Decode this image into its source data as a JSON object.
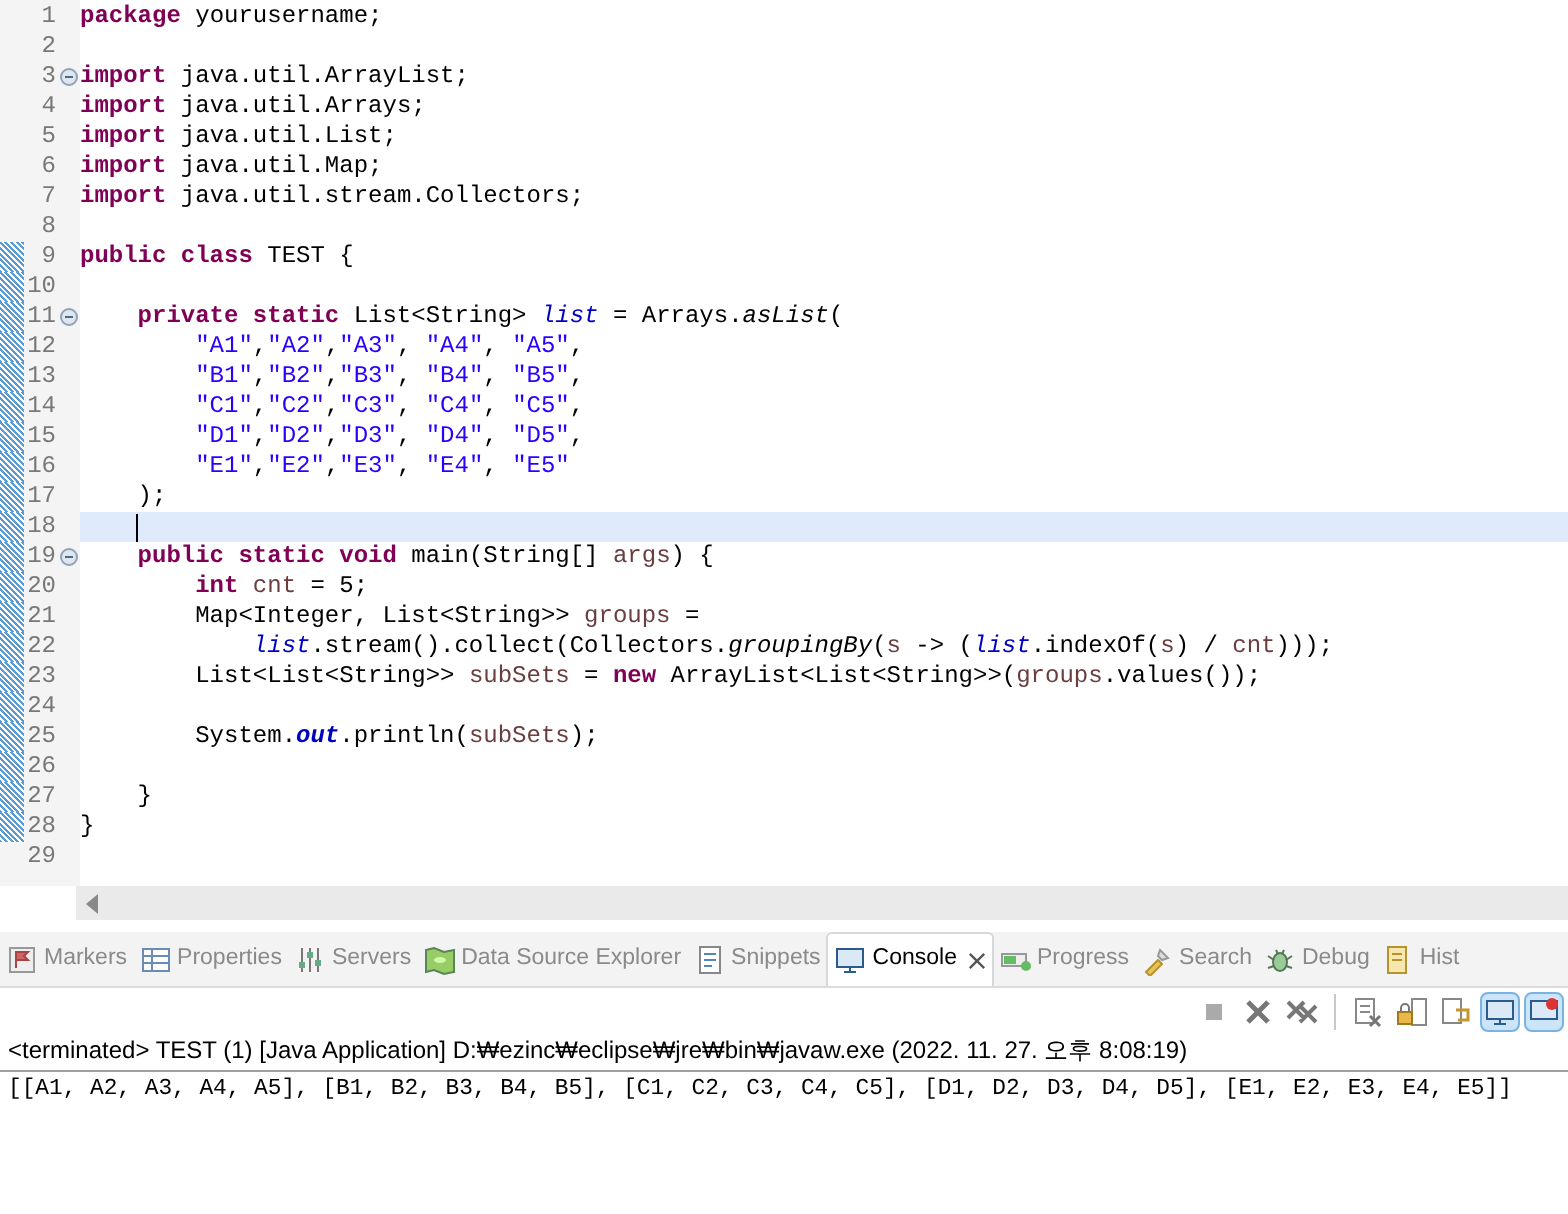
{
  "editor": {
    "lines": [
      {
        "number": "1",
        "fold": false,
        "changed": false,
        "current": false,
        "tokens": [
          {
            "kind": "keyword",
            "text": "package"
          },
          {
            "kind": "plain",
            "text": " yourusername;"
          }
        ]
      },
      {
        "number": "2",
        "fold": false,
        "changed": false,
        "current": false
      },
      {
        "number": "3",
        "fold": true,
        "changed": false,
        "current": false,
        "tokens": [
          {
            "kind": "keyword",
            "text": "import"
          },
          {
            "kind": "plain",
            "text": " java.util.ArrayList;"
          }
        ]
      },
      {
        "number": "4",
        "fold": false,
        "changed": false,
        "current": false,
        "tokens": [
          {
            "kind": "keyword",
            "text": "import"
          },
          {
            "kind": "plain",
            "text": " java.util.Arrays;"
          }
        ]
      },
      {
        "number": "5",
        "fold": false,
        "changed": false,
        "current": false,
        "tokens": [
          {
            "kind": "keyword",
            "text": "import"
          },
          {
            "kind": "plain",
            "text": " java.util.List;"
          }
        ]
      },
      {
        "number": "6",
        "fold": false,
        "changed": false,
        "current": false,
        "tokens": [
          {
            "kind": "keyword",
            "text": "import"
          },
          {
            "kind": "plain",
            "text": " java.util.Map;"
          }
        ]
      },
      {
        "number": "7",
        "fold": false,
        "changed": false,
        "current": false,
        "tokens": [
          {
            "kind": "keyword",
            "text": "import"
          },
          {
            "kind": "plain",
            "text": " java.util.stream.Collectors;"
          }
        ]
      },
      {
        "number": "8",
        "fold": false,
        "changed": false,
        "current": false
      },
      {
        "number": "9",
        "fold": false,
        "changed": true,
        "current": false,
        "tokens": [
          {
            "kind": "keyword",
            "text": "public class"
          },
          {
            "kind": "plain",
            "text": " TEST {"
          }
        ]
      },
      {
        "number": "10",
        "fold": false,
        "changed": true,
        "current": false
      },
      {
        "number": "11",
        "fold": true,
        "changed": true,
        "current": false,
        "tokens": [
          {
            "kind": "keyword",
            "text": "    private static"
          },
          {
            "kind": "plain",
            "text": " List<String> "
          },
          {
            "kind": "field",
            "text": "list"
          },
          {
            "kind": "plain",
            "text": " = Arrays."
          },
          {
            "kind": "static-method",
            "text": "asList"
          },
          {
            "kind": "plain",
            "text": "("
          }
        ]
      },
      {
        "number": "12",
        "fold": false,
        "changed": true,
        "current": false,
        "tokens": [
          {
            "kind": "string",
            "text": "        \"A1\""
          },
          {
            "kind": "plain",
            "text": ","
          },
          {
            "kind": "string",
            "text": "\"A2\""
          },
          {
            "kind": "plain",
            "text": ","
          },
          {
            "kind": "string",
            "text": "\"A3\""
          },
          {
            "kind": "plain",
            "text": ", "
          },
          {
            "kind": "string",
            "text": "\"A4\""
          },
          {
            "kind": "plain",
            "text": ", "
          },
          {
            "kind": "string",
            "text": "\"A5\""
          },
          {
            "kind": "plain",
            "text": ","
          }
        ]
      },
      {
        "number": "13",
        "fold": false,
        "changed": true,
        "current": false,
        "tokens": [
          {
            "kind": "string",
            "text": "        \"B1\""
          },
          {
            "kind": "plain",
            "text": ","
          },
          {
            "kind": "string",
            "text": "\"B2\""
          },
          {
            "kind": "plain",
            "text": ","
          },
          {
            "kind": "string",
            "text": "\"B3\""
          },
          {
            "kind": "plain",
            "text": ", "
          },
          {
            "kind": "string",
            "text": "\"B4\""
          },
          {
            "kind": "plain",
            "text": ", "
          },
          {
            "kind": "string",
            "text": "\"B5\""
          },
          {
            "kind": "plain",
            "text": ","
          }
        ]
      },
      {
        "number": "14",
        "fold": false,
        "changed": true,
        "current": false,
        "tokens": [
          {
            "kind": "string",
            "text": "        \"C1\""
          },
          {
            "kind": "plain",
            "text": ","
          },
          {
            "kind": "string",
            "text": "\"C2\""
          },
          {
            "kind": "plain",
            "text": ","
          },
          {
            "kind": "string",
            "text": "\"C3\""
          },
          {
            "kind": "plain",
            "text": ", "
          },
          {
            "kind": "string",
            "text": "\"C4\""
          },
          {
            "kind": "plain",
            "text": ", "
          },
          {
            "kind": "string",
            "text": "\"C5\""
          },
          {
            "kind": "plain",
            "text": ","
          }
        ]
      },
      {
        "number": "15",
        "fold": false,
        "changed": true,
        "current": false,
        "tokens": [
          {
            "kind": "string",
            "text": "        \"D1\""
          },
          {
            "kind": "plain",
            "text": ","
          },
          {
            "kind": "string",
            "text": "\"D2\""
          },
          {
            "kind": "plain",
            "text": ","
          },
          {
            "kind": "string",
            "text": "\"D3\""
          },
          {
            "kind": "plain",
            "text": ", "
          },
          {
            "kind": "string",
            "text": "\"D4\""
          },
          {
            "kind": "plain",
            "text": ", "
          },
          {
            "kind": "string",
            "text": "\"D5\""
          },
          {
            "kind": "plain",
            "text": ","
          }
        ]
      },
      {
        "number": "16",
        "fold": false,
        "changed": true,
        "current": false,
        "tokens": [
          {
            "kind": "string",
            "text": "        \"E1\""
          },
          {
            "kind": "plain",
            "text": ","
          },
          {
            "kind": "string",
            "text": "\"E2\""
          },
          {
            "kind": "plain",
            "text": ","
          },
          {
            "kind": "string",
            "text": "\"E3\""
          },
          {
            "kind": "plain",
            "text": ", "
          },
          {
            "kind": "string",
            "text": "\"E4\""
          },
          {
            "kind": "plain",
            "text": ", "
          },
          {
            "kind": "string",
            "text": "\"E5\""
          }
        ]
      },
      {
        "number": "17",
        "fold": false,
        "changed": true,
        "current": false,
        "tokens": [
          {
            "kind": "plain",
            "text": "    );"
          }
        ]
      },
      {
        "number": "18",
        "fold": false,
        "changed": true,
        "current": true
      },
      {
        "number": "19",
        "fold": true,
        "changed": true,
        "current": false,
        "tokens": [
          {
            "kind": "keyword",
            "text": "    public static void"
          },
          {
            "kind": "plain",
            "text": " main(String[] "
          },
          {
            "kind": "local",
            "text": "args"
          },
          {
            "kind": "plain",
            "text": ") {"
          }
        ]
      },
      {
        "number": "20",
        "fold": false,
        "changed": true,
        "current": false,
        "tokens": [
          {
            "kind": "keyword",
            "text": "        int"
          },
          {
            "kind": "local",
            "text": " cnt"
          },
          {
            "kind": "plain",
            "text": " = 5;"
          }
        ]
      },
      {
        "number": "21",
        "fold": false,
        "changed": true,
        "current": false,
        "tokens": [
          {
            "kind": "plain",
            "text": "        Map<Integer, List<String>> "
          },
          {
            "kind": "local",
            "text": "groups"
          },
          {
            "kind": "plain",
            "text": " ="
          }
        ]
      },
      {
        "number": "22",
        "fold": false,
        "changed": true,
        "current": false,
        "tokens": [
          {
            "kind": "field",
            "text": "            list"
          },
          {
            "kind": "plain",
            "text": ".stream().collect(Collectors."
          },
          {
            "kind": "static-method",
            "text": "groupingBy"
          },
          {
            "kind": "plain",
            "text": "("
          },
          {
            "kind": "local",
            "text": "s"
          },
          {
            "kind": "plain",
            "text": " -> ("
          },
          {
            "kind": "field",
            "text": "list"
          },
          {
            "kind": "plain",
            "text": ".indexOf("
          },
          {
            "kind": "local",
            "text": "s"
          },
          {
            "kind": "plain",
            "text": ") / "
          },
          {
            "kind": "local",
            "text": "cnt"
          },
          {
            "kind": "plain",
            "text": ")));"
          }
        ]
      },
      {
        "number": "23",
        "fold": false,
        "changed": true,
        "current": false,
        "tokens": [
          {
            "kind": "plain",
            "text": "        List<List<String>> "
          },
          {
            "kind": "local",
            "text": "subSets"
          },
          {
            "kind": "plain",
            "text": " = "
          },
          {
            "kind": "keyword",
            "text": "new"
          },
          {
            "kind": "plain",
            "text": " ArrayList<List<String>>("
          },
          {
            "kind": "local",
            "text": "groups"
          },
          {
            "kind": "plain",
            "text": ".values());"
          }
        ]
      },
      {
        "number": "24",
        "fold": false,
        "changed": true,
        "current": false
      },
      {
        "number": "25",
        "fold": false,
        "changed": true,
        "current": false,
        "tokens": [
          {
            "kind": "plain",
            "text": "        System."
          },
          {
            "kind": "static-field",
            "text": "out"
          },
          {
            "kind": "plain",
            "text": ".println("
          },
          {
            "kind": "local",
            "text": "subSets"
          },
          {
            "kind": "plain",
            "text": ");"
          }
        ]
      },
      {
        "number": "26",
        "fold": false,
        "changed": true,
        "current": false
      },
      {
        "number": "27",
        "fold": false,
        "changed": true,
        "current": false,
        "tokens": [
          {
            "kind": "plain",
            "text": "    }"
          }
        ]
      },
      {
        "number": "28",
        "fold": false,
        "changed": true,
        "current": false,
        "tokens": [
          {
            "kind": "plain",
            "text": "}"
          }
        ]
      },
      {
        "number": "29",
        "fold": false,
        "changed": false,
        "current": false
      }
    ]
  },
  "tabs": [
    {
      "kind": "markers",
      "label": "Markers",
      "selected": false
    },
    {
      "kind": "properties",
      "label": "Properties",
      "selected": false
    },
    {
      "kind": "servers",
      "label": "Servers",
      "selected": false
    },
    {
      "kind": "datasource",
      "label": "Data Source Explorer",
      "selected": false
    },
    {
      "kind": "snippets",
      "label": "Snippets",
      "selected": false
    },
    {
      "kind": "console",
      "label": "Console",
      "selected": true
    },
    {
      "kind": "progress",
      "label": "Progress",
      "selected": false
    },
    {
      "kind": "search",
      "label": "Search",
      "selected": false
    },
    {
      "kind": "debug",
      "label": "Debug",
      "selected": false
    },
    {
      "kind": "history",
      "label": "Hist",
      "selected": false
    }
  ],
  "toolbar": [
    {
      "kind": "stop",
      "pressed": false
    },
    {
      "kind": "remove",
      "pressed": false
    },
    {
      "kind": "remove-all",
      "pressed": false
    },
    {
      "kind": "separator"
    },
    {
      "kind": "clear",
      "pressed": false
    },
    {
      "kind": "scroll-lock",
      "pressed": false
    },
    {
      "kind": "word-wrap",
      "pressed": false
    },
    {
      "kind": "pin",
      "pressed": true
    },
    {
      "kind": "show-console",
      "pressed": true
    }
  ],
  "console": {
    "header": "<terminated> TEST (1) [Java Application] D:₩ezinc₩eclipse₩jre₩bin₩javaw.exe (2022. 11. 27. 오후 8:08:19)",
    "output": "[[A1, A2, A3, A4, A5], [B1, B2, B3, B4, B5], [C1, C2, C3, C4, C5], [D1, D2, D3, D4, D5], [E1, E2, E3, E4, E5]]"
  }
}
